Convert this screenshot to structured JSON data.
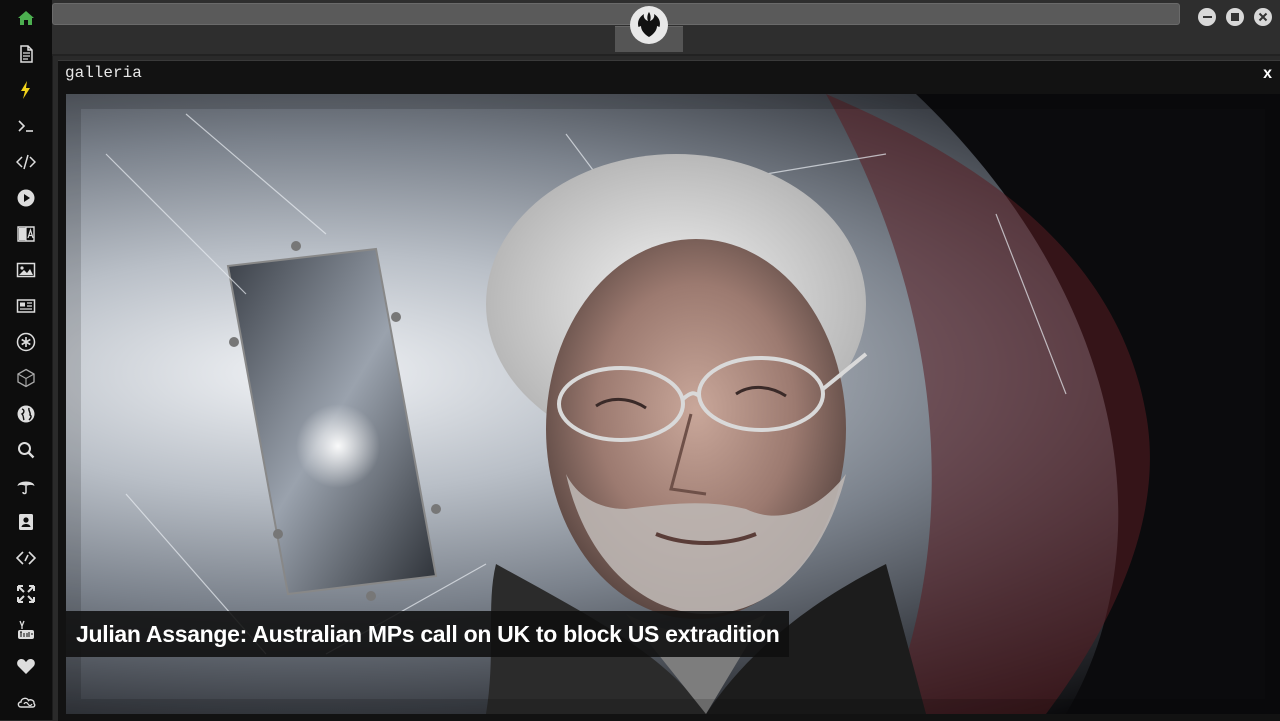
{
  "sidebar": {
    "items": [
      {
        "icon": "home-icon",
        "active": true
      },
      {
        "icon": "document-icon"
      },
      {
        "icon": "lightning-icon"
      },
      {
        "icon": "terminal-icon"
      },
      {
        "icon": "code-icon"
      },
      {
        "icon": "play-icon"
      },
      {
        "icon": "translate-icon"
      },
      {
        "icon": "image-icon"
      },
      {
        "icon": "newspaper-icon"
      },
      {
        "icon": "asterisk-icon"
      },
      {
        "icon": "cube-icon"
      },
      {
        "icon": "globe-icon"
      },
      {
        "icon": "search-icon"
      },
      {
        "icon": "umbrella-icon"
      },
      {
        "icon": "contact-icon"
      },
      {
        "icon": "embed-icon"
      },
      {
        "icon": "expand-icon"
      },
      {
        "icon": "youtube-icon"
      },
      {
        "icon": "heart-icon"
      },
      {
        "icon": "cloud-icon"
      }
    ],
    "accent": "#4caf50"
  },
  "topbar": {
    "logo": "rebel-alliance-icon"
  },
  "gallery": {
    "title": "galleria",
    "close_label": "x",
    "caption": "Julian Assange: Australian MPs call on UK to block US extradition"
  }
}
